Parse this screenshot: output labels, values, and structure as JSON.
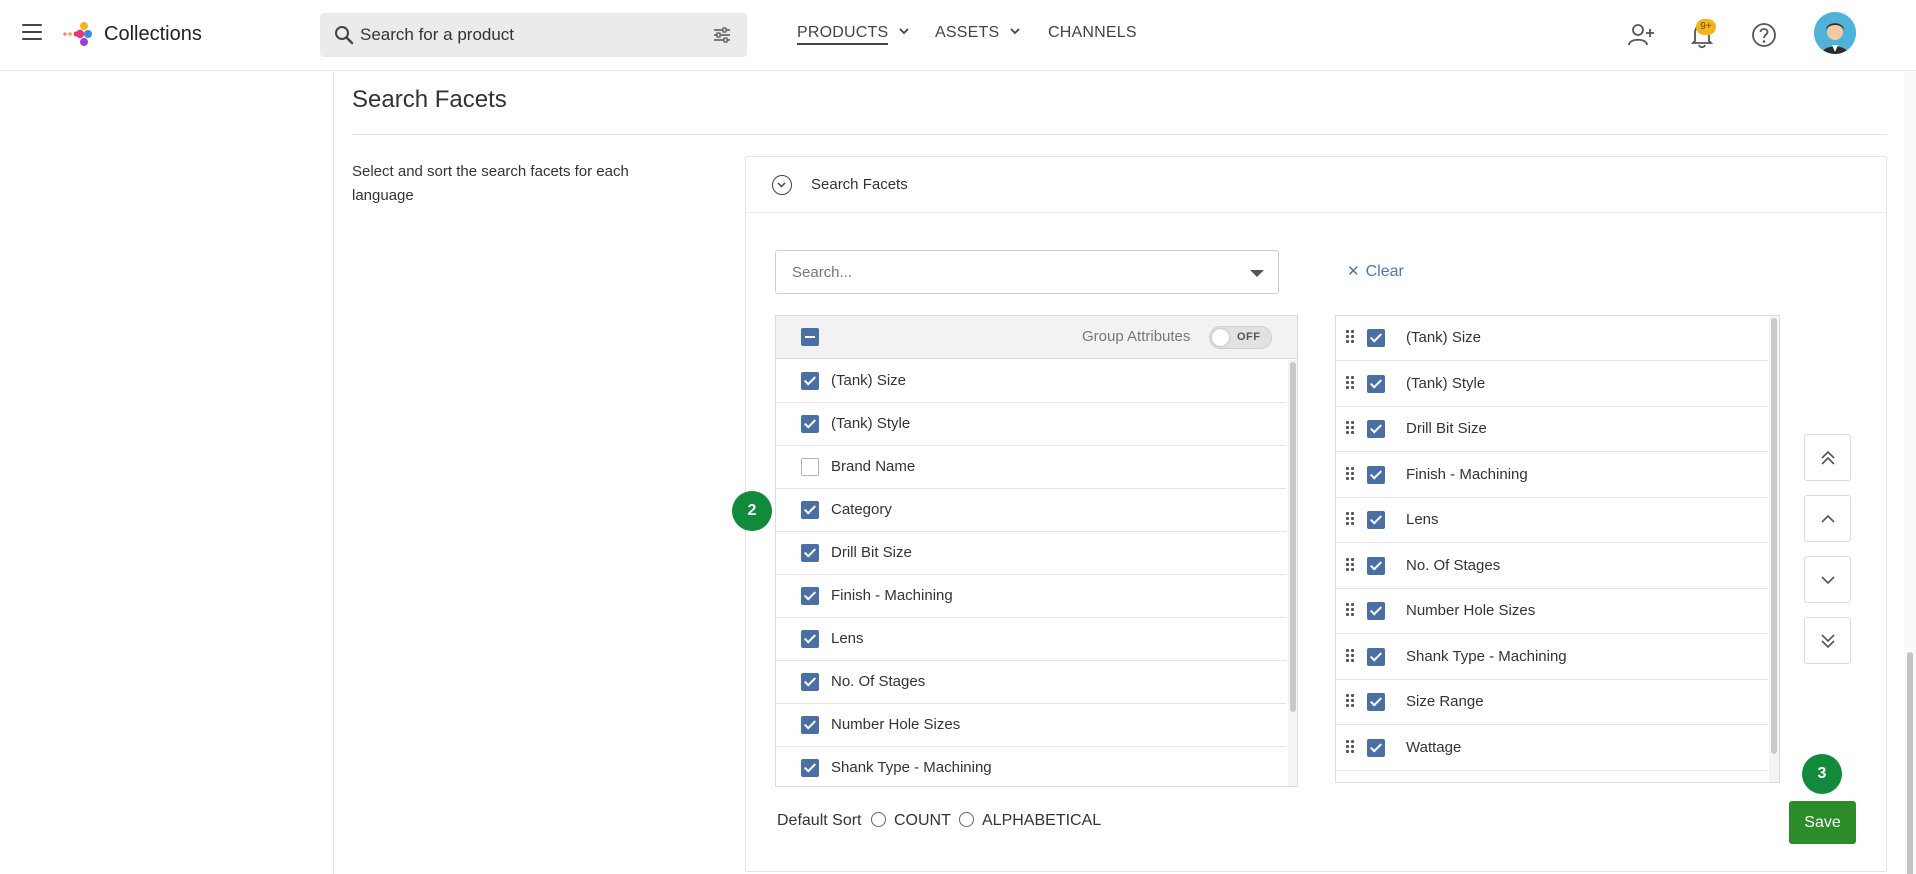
{
  "header": {
    "app_title": "Collections",
    "search_placeholder": "Search for a product",
    "nav": [
      {
        "label": "PRODUCTS"
      },
      {
        "label": "ASSETS"
      },
      {
        "label": "CHANNELS"
      }
    ],
    "notification_badge": "9+",
    "icons": [
      "menu-icon",
      "logo-icon",
      "search-icon",
      "filter-icon",
      "add-user-icon",
      "bell-icon",
      "help-icon",
      "avatar"
    ]
  },
  "page": {
    "section_title": "Search Facets",
    "description": "Select and sort the search facets for each language"
  },
  "panel": {
    "title": "Search Facets",
    "dropdown_placeholder": "Search...",
    "clear_label": "Clear",
    "group_attributes_label": "Group Attributes",
    "toggle_state": "OFF"
  },
  "left_list": [
    {
      "label": "(Tank) Size",
      "checked": true
    },
    {
      "label": "(Tank) Style",
      "checked": true
    },
    {
      "label": "Brand Name",
      "checked": false
    },
    {
      "label": "Category",
      "checked": true
    },
    {
      "label": "Drill Bit Size",
      "checked": true
    },
    {
      "label": "Finish - Machining",
      "checked": true
    },
    {
      "label": "Lens",
      "checked": true
    },
    {
      "label": "No. Of Stages",
      "checked": true
    },
    {
      "label": "Number Hole Sizes",
      "checked": true
    },
    {
      "label": "Shank Type - Machining",
      "checked": true
    }
  ],
  "right_list": [
    {
      "label": "(Tank) Size",
      "checked": true
    },
    {
      "label": "(Tank) Style",
      "checked": true
    },
    {
      "label": "Drill Bit Size",
      "checked": true
    },
    {
      "label": "Finish - Machining",
      "checked": true
    },
    {
      "label": "Lens",
      "checked": true
    },
    {
      "label": "No. Of Stages",
      "checked": true
    },
    {
      "label": "Number Hole Sizes",
      "checked": true
    },
    {
      "label": "Shank Type - Machining",
      "checked": true
    },
    {
      "label": "Size Range",
      "checked": true
    },
    {
      "label": "Wattage",
      "checked": true
    },
    {
      "label": "",
      "checked": true
    }
  ],
  "move_buttons": [
    "move-to-top",
    "move-up",
    "move-down",
    "move-to-bottom"
  ],
  "steps": {
    "two": "2",
    "three": "3"
  },
  "sort": {
    "label": "Default Sort",
    "options": [
      "COUNT",
      "ALPHABETICAL"
    ]
  },
  "save_label": "Save",
  "colors": {
    "checkbox": "#4a6fa5",
    "save": "#2c8c2a",
    "step_badge": "#118a3c",
    "link": "#4a78b5",
    "badge": "#f2b51c"
  }
}
